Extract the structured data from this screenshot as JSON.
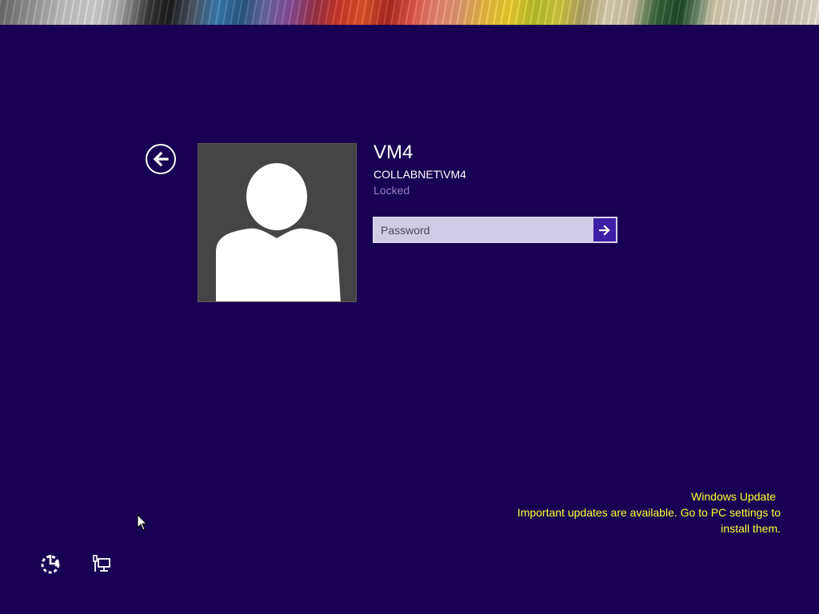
{
  "colors": {
    "background": "#180052",
    "submit_button": "#3d1fa6",
    "password_field": "#d0cbe6",
    "status_text": "#8f82c4",
    "notice_text": "#ffff33",
    "avatar_tile": "#454545"
  },
  "user": {
    "name": "VM4",
    "account": "COLLABNET\\VM4",
    "status": "Locked",
    "avatar_icon": "default-user-icon"
  },
  "password": {
    "placeholder": "Password",
    "value": "",
    "submit_icon": "arrow-right-icon"
  },
  "back_icon": "arrow-left-circle-icon",
  "notification": {
    "title": "Windows Update",
    "message_line1": "Important updates are available. Go to PC settings to",
    "message_line2": "install them."
  },
  "bottom_icons": [
    "ease-of-access-icon",
    "network-icon"
  ]
}
